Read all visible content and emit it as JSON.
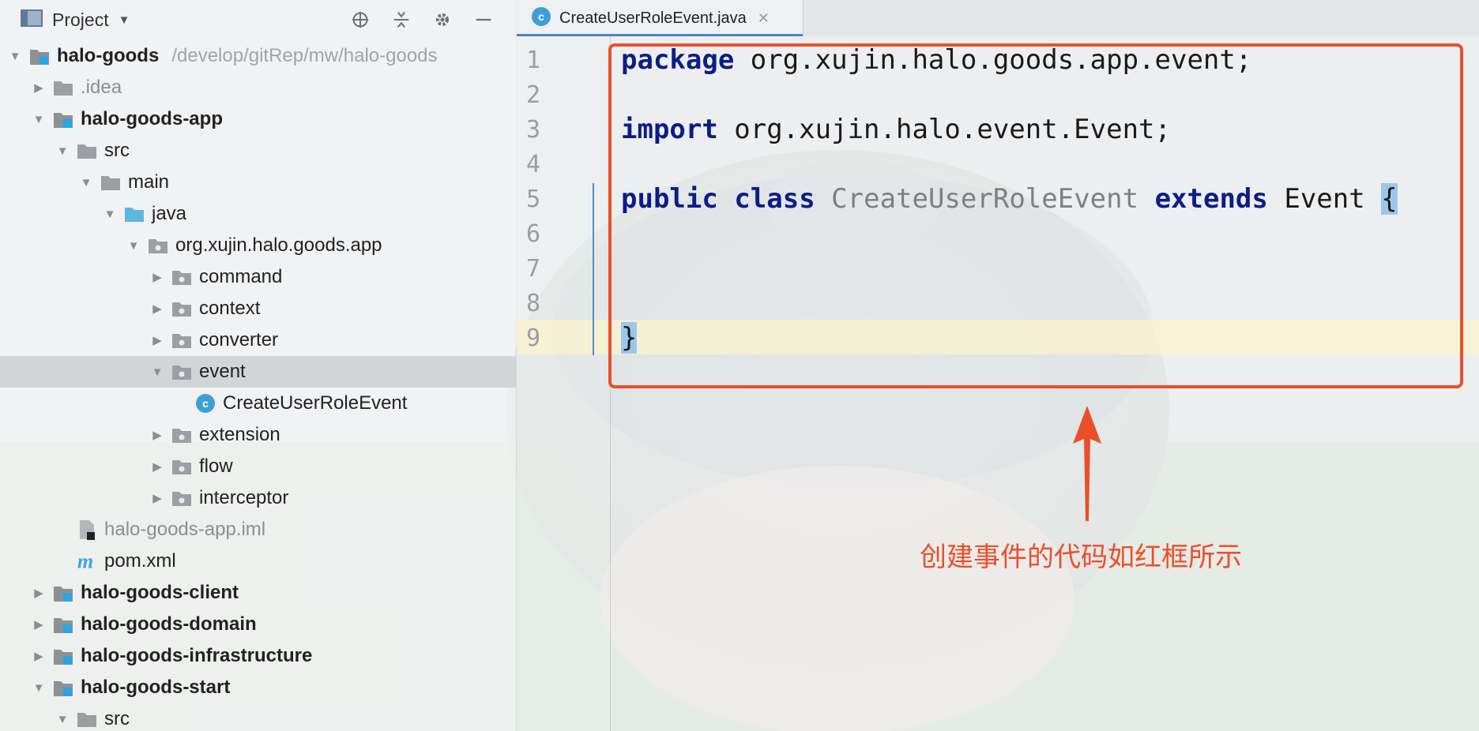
{
  "project_panel": {
    "title": "Project",
    "tree": [
      {
        "label": "halo-goods",
        "path": "/develop/gitRep/mw/halo-goods",
        "depth": 0,
        "expanded": true,
        "icon": "module-icon",
        "bold": true
      },
      {
        "label": ".idea",
        "depth": 1,
        "expanded": false,
        "icon": "folder-icon",
        "grey": true
      },
      {
        "label": "halo-goods-app",
        "depth": 1,
        "expanded": true,
        "icon": "module-icon",
        "bold": true
      },
      {
        "label": "src",
        "depth": 2,
        "expanded": true,
        "icon": "folder-icon"
      },
      {
        "label": "main",
        "depth": 3,
        "expanded": true,
        "icon": "folder-icon"
      },
      {
        "label": "java",
        "depth": 4,
        "expanded": true,
        "icon": "source-folder-icon"
      },
      {
        "label": "org.xujin.halo.goods.app",
        "depth": 5,
        "expanded": true,
        "icon": "package-icon"
      },
      {
        "label": "command",
        "depth": 6,
        "expanded": false,
        "icon": "package-icon"
      },
      {
        "label": "context",
        "depth": 6,
        "expanded": false,
        "icon": "package-icon"
      },
      {
        "label": "converter",
        "depth": 6,
        "expanded": false,
        "icon": "package-icon"
      },
      {
        "label": "event",
        "depth": 6,
        "expanded": true,
        "icon": "package-icon",
        "selected": true
      },
      {
        "label": "CreateUserRoleEvent",
        "depth": 7,
        "icon": "java-class-icon"
      },
      {
        "label": "extension",
        "depth": 6,
        "expanded": false,
        "icon": "package-icon"
      },
      {
        "label": "flow",
        "depth": 6,
        "expanded": false,
        "icon": "package-icon"
      },
      {
        "label": "interceptor",
        "depth": 6,
        "expanded": false,
        "icon": "package-icon"
      },
      {
        "label": "halo-goods-app.iml",
        "depth": 2,
        "icon": "iml-file-icon",
        "grey": true
      },
      {
        "label": "pom.xml",
        "depth": 2,
        "icon": "maven-icon"
      },
      {
        "label": "halo-goods-client",
        "depth": 1,
        "expanded": false,
        "icon": "module-icon",
        "bold": true
      },
      {
        "label": "halo-goods-domain",
        "depth": 1,
        "expanded": false,
        "icon": "module-icon",
        "bold": true
      },
      {
        "label": "halo-goods-infrastructure",
        "depth": 1,
        "expanded": false,
        "icon": "module-icon",
        "bold": true
      },
      {
        "label": "halo-goods-start",
        "depth": 1,
        "expanded": true,
        "icon": "module-icon",
        "bold": true
      },
      {
        "label": "src",
        "depth": 2,
        "expanded": true,
        "icon": "folder-icon"
      }
    ]
  },
  "editor": {
    "tab_label": "CreateUserRoleEvent.java",
    "lines": [
      {
        "num": "1",
        "tokens": [
          {
            "t": "package",
            "c": "kw"
          },
          {
            "t": " org.xujin.halo.goods.app.event;",
            "c": ""
          }
        ]
      },
      {
        "num": "2",
        "tokens": []
      },
      {
        "num": "3",
        "tokens": [
          {
            "t": "import",
            "c": "kw"
          },
          {
            "t": " org.xujin.halo.event.Event;",
            "c": ""
          }
        ]
      },
      {
        "num": "4",
        "tokens": []
      },
      {
        "num": "5",
        "tokens": [
          {
            "t": "public",
            "c": "kw"
          },
          {
            "t": " ",
            "c": ""
          },
          {
            "t": "class",
            "c": "kw"
          },
          {
            "t": " ",
            "c": ""
          },
          {
            "t": "CreateUserRoleEvent",
            "c": "cls"
          },
          {
            "t": " ",
            "c": ""
          },
          {
            "t": "extends",
            "c": "kw"
          },
          {
            "t": " Event ",
            "c": ""
          },
          {
            "t": "{",
            "c": "brace"
          }
        ]
      },
      {
        "num": "6",
        "tokens": []
      },
      {
        "num": "7",
        "tokens": []
      },
      {
        "num": "8",
        "tokens": []
      },
      {
        "num": "9",
        "tokens": [
          {
            "t": "}",
            "c": "brace"
          }
        ]
      }
    ]
  },
  "annotation": {
    "text": "创建事件的代码如红框所示",
    "color": "#eb4f2a"
  },
  "colors": {
    "keyword": "#0b1d86",
    "class_name": "#7d7f83",
    "brace_highlight": "#9dc7ea",
    "annotation_red": "#eb4f2a"
  }
}
